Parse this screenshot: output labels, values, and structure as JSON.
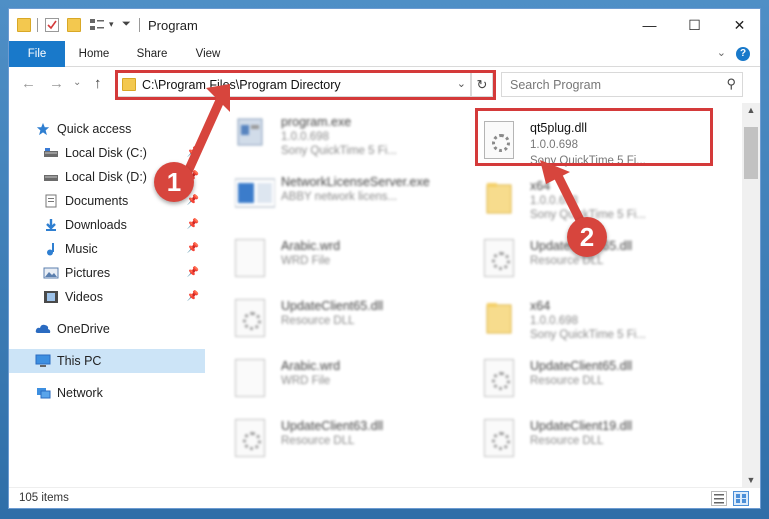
{
  "window": {
    "title": "Program",
    "buttons": {
      "minimize": "—",
      "maximize": "☐",
      "close": "✕"
    }
  },
  "ribbon": {
    "tabs": [
      {
        "label": "File"
      },
      {
        "label": "Home"
      },
      {
        "label": "Share"
      },
      {
        "label": "View"
      }
    ],
    "help": "?",
    "collapse": "⌄"
  },
  "nav": {
    "back": "←",
    "forward": "→",
    "dropdown": "⌄",
    "up": "↑",
    "address": "C:\\Program Files\\Program Directory",
    "address_chevron": "⌄",
    "refresh": "↻",
    "search_placeholder": "Search Program",
    "search_icon": "⚲"
  },
  "sidebar": {
    "items": [
      {
        "label": "Quick access",
        "icon": "star-icon",
        "pinned": false
      },
      {
        "label": "Local Disk (C:)",
        "icon": "drive-icon",
        "pinned": true
      },
      {
        "label": "Local Disk (D:)",
        "icon": "drive-icon",
        "pinned": true
      },
      {
        "label": "Documents",
        "icon": "documents-icon",
        "pinned": true
      },
      {
        "label": "Downloads",
        "icon": "downloads-icon",
        "pinned": true
      },
      {
        "label": "Music",
        "icon": "music-icon",
        "pinned": true
      },
      {
        "label": "Pictures",
        "icon": "pictures-icon",
        "pinned": true
      },
      {
        "label": "Videos",
        "icon": "videos-icon",
        "pinned": true
      },
      {
        "label": "OneDrive",
        "icon": "cloud-icon",
        "pinned": false
      },
      {
        "label": "This PC",
        "icon": "computer-icon",
        "pinned": false,
        "selected": true
      },
      {
        "label": "Network",
        "icon": "network-icon",
        "pinned": false
      }
    ]
  },
  "files": [
    {
      "name": "program.exe",
      "line2": "1.0.0.698",
      "line3": "Sony QuickTime 5 Fi...",
      "icon": "exe-icon"
    },
    {
      "name": "qt5plug.dll",
      "line2": "1.0.0.698",
      "line3": "Sony QuickTime 5 Fi...",
      "icon": "dll-icon"
    },
    {
      "name": "NetworkLicenseServer.exe",
      "line2": "ABBY network licens...",
      "icon": "exe-icon"
    },
    {
      "name": "x64",
      "line2": "1.0.0.698",
      "line3": "Sony QuickTime 5 Fi...",
      "icon": "folder-icon"
    },
    {
      "name": "Arabic.wrd",
      "line2": "WRD File",
      "icon": "page-icon"
    },
    {
      "name": "UpdateClient65.dll",
      "line2": "Resource DLL",
      "icon": "dll-icon"
    },
    {
      "name": "UpdateClient65.dll",
      "line2": "Resource DLL",
      "icon": "dll-icon"
    },
    {
      "name": "x64",
      "line2": "1.0.0.698",
      "line3": "Sony QuickTime 5 Fi...",
      "icon": "folder-icon"
    },
    {
      "name": "Arabic.wrd",
      "line2": "WRD File",
      "icon": "page-icon"
    },
    {
      "name": "UpdateClient65.dll",
      "line2": "Resource DLL",
      "icon": "dll-icon"
    },
    {
      "name": "UpdateClient63.dll",
      "line2": "Resource DLL",
      "icon": "dll-icon"
    },
    {
      "name": "UpdateClient19.dll",
      "line2": "Resource DLL",
      "icon": "dll-icon"
    }
  ],
  "status": {
    "count": "105 items"
  },
  "callouts": [
    "1",
    "2"
  ],
  "colors": {
    "accent": "#1979ca",
    "highlight": "#d43a3a",
    "selected": "#cce4f7"
  }
}
